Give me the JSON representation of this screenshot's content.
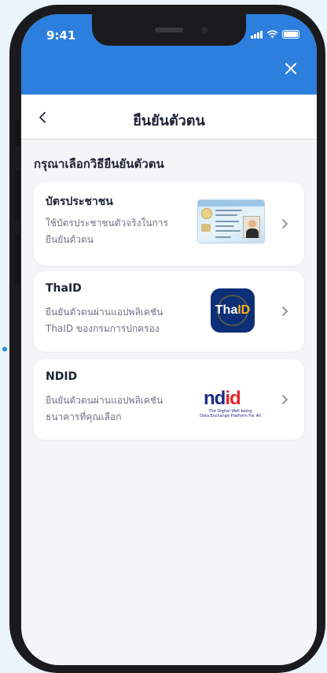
{
  "status_bar": {
    "time": "9:41"
  },
  "header": {
    "close_icon": "close-icon"
  },
  "nav": {
    "title": "ยืนยันตัวตน",
    "back_icon": "chevron-left-icon"
  },
  "section_title": "กรุณาเลือกวิธียืนยันตัวตน",
  "methods": [
    {
      "title": "บัตรประชาชน",
      "description_line1": "ใช้บัตรประชาชนตัวจริงในการ",
      "description_line2": "ยืนยันตัวตน",
      "icon": "thai-id-card-image"
    },
    {
      "title": "ThaID",
      "description_line1": "ยืนยันตัวตนผ่านแอปพลิเคชัน",
      "description_line2": "ThaID ของกรมการปกครอง",
      "icon": "thaid-app-logo",
      "logo_text_main": "Tha",
      "logo_text_accent": "ID"
    },
    {
      "title": "NDID",
      "description_line1": "ยืนยันตัวตนผ่านแอปพลิเคชัน",
      "description_line2": "ธนาคารที่คุณเลือก",
      "icon": "ndid-logo",
      "logo_text_main": "nd",
      "logo_text_accent": "id",
      "logo_tagline1": "The Digital Well-being",
      "logo_tagline2": "Data Exchange Platform For All"
    }
  ],
  "colors": {
    "header_blue": "#2d7fde",
    "background": "#f4f5f7",
    "text_primary": "#1d2233",
    "text_secondary": "#6f7480"
  }
}
